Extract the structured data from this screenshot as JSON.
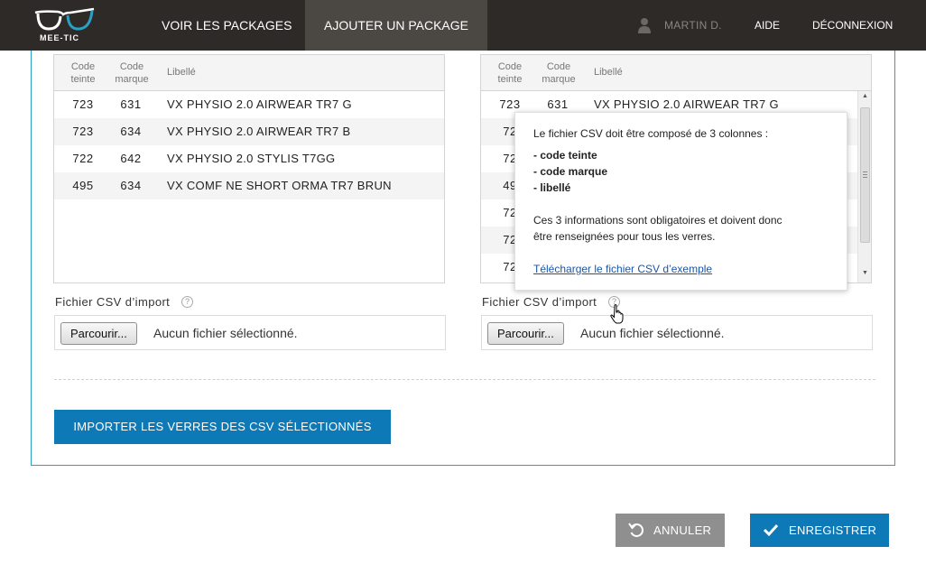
{
  "brand": {
    "name": "MEE-TIC"
  },
  "nav": {
    "voir": "VOIR LES PACKAGES",
    "ajouter": "AJOUTER UN PACKAGE",
    "user": "MARTIN D.",
    "aide": "AIDE",
    "deconnexion": "DÉCONNEXION"
  },
  "table_headers": {
    "teinte_1": "Code",
    "teinte_2": "teinte",
    "marque_1": "Code",
    "marque_2": "marque",
    "libelle": "Libellé"
  },
  "left_table": {
    "rows": [
      {
        "teinte": "723",
        "marque": "631",
        "libelle": "VX PHYSIO 2.0 AIRWEAR TR7 G"
      },
      {
        "teinte": "723",
        "marque": "634",
        "libelle": "VX PHYSIO 2.0 AIRWEAR TR7 B"
      },
      {
        "teinte": "722",
        "marque": "642",
        "libelle": "VX PHYSIO 2.0 STYLIS T7GG"
      },
      {
        "teinte": "495",
        "marque": "634",
        "libelle": "VX COMF NE SHORT ORMA TR7 BRUN"
      }
    ]
  },
  "right_table": {
    "rows": [
      {
        "teinte": "723",
        "marque": "631",
        "libelle": "VX PHYSIO 2.0 AIRWEAR TR7 G"
      },
      {
        "teinte": "72",
        "marque": "",
        "libelle": ""
      },
      {
        "teinte": "72",
        "marque": "",
        "libelle": ""
      },
      {
        "teinte": "49",
        "marque": "",
        "libelle": ""
      },
      {
        "teinte": "72",
        "marque": "",
        "libelle": ""
      },
      {
        "teinte": "72",
        "marque": "",
        "libelle": ""
      },
      {
        "teinte": "72",
        "marque": "",
        "libelle": ""
      }
    ]
  },
  "file_input": {
    "label": "Fichier CSV d’import",
    "help": "?",
    "browse": "Parcourir...",
    "status": "Aucun fichier sélectionné."
  },
  "import_button": "IMPORTER LES VERRES DES CSV SÉLECTIONNÉS",
  "cancel_button": "ANNULER",
  "save_button": "ENREGISTRER",
  "tooltip": {
    "intro": "Le fichier CSV doit être composé de 3 colonnes :",
    "col1": "- code teinte",
    "col2": "- code marque",
    "col3": "- libellé",
    "info1": "Ces 3 informations sont obligatoires et doivent donc",
    "info2": "être renseignées pour tous les verres.",
    "link": "Télécharger le fichier CSV d’exemple"
  },
  "colors": {
    "topbar": "#2e2a27",
    "accent": "#0d79b6",
    "panel_border": "#2aa0c4",
    "cancel": "#8f8f8f"
  }
}
